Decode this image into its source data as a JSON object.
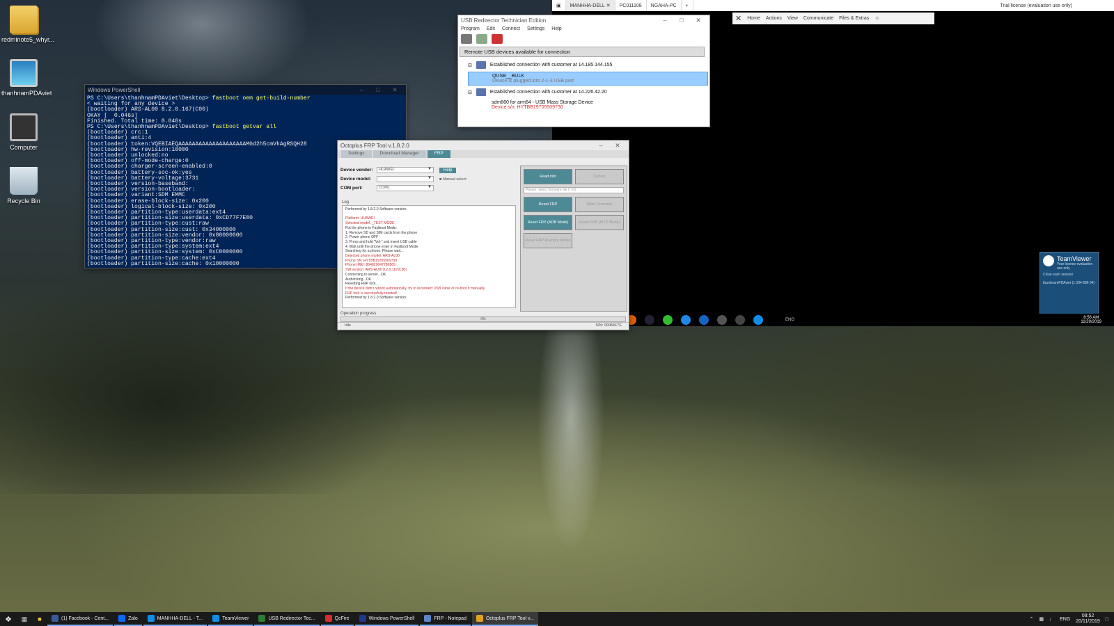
{
  "desktop": {
    "icons": [
      {
        "label": "redminote5_whyr..."
      },
      {
        "label": "thanhnamPDAviet"
      },
      {
        "label": "Computer"
      },
      {
        "label": "Recycle Bin"
      }
    ]
  },
  "powershell": {
    "title": "Windows PowerShell",
    "lines": [
      "PS C:\\Users\\thanhnamPDAviet\\Desktop> fastboot oem get-build-number",
      "< waiting for any device >",
      "(bootloader) ARS-AL00 8.2.0.167(C00)",
      "OKAY [  0.046s]",
      "Finished. Total time: 0.048s",
      "PS C:\\Users\\thanhnamPDAviet\\Desktop> fastboot getvar all",
      "(bootloader) crc:1",
      "(bootloader) anti:4",
      "(bootloader) token:VQEBIAEQAAAAAAAAAAAAAAAAAAAAMGd2h5cmVkAgRSQH28",
      "(bootloader) hw-revision:10000",
      "(bootloader) unlocked:no",
      "(bootloader) off-mode-charge:0",
      "(bootloader) charger-screen-enabled:0",
      "(bootloader) battery-soc-ok:yes",
      "(bootloader) battery-voltage:3731",
      "(bootloader) version-baseband:",
      "(bootloader) version-bootloader:",
      "(bootloader) variant:SDM EMMC",
      "(bootloader) erase-block-size: 0x200",
      "(bootloader) logical-block-size: 0x200",
      "(bootloader) partition-type:userdata:ext4",
      "(bootloader) partition-size:userdata: 0xCD77F7E00",
      "(bootloader) partition-type:cust:raw",
      "(bootloader) partition-size:cust: 0x34000000",
      "(bootloader) partition-size:vendor: 0x80000000",
      "(bootloader) partition-type:vendor:raw",
      "(bootloader) partition-type:system:ext4",
      "(bootloader) partition-size:system: 0xC0000000",
      "(bootloader) partition-type:cache:ext4",
      "(bootloader) partition-size:cache: 0x10000000"
    ]
  },
  "teamviewer": {
    "tabs": [
      "MANHHA-DELL",
      "PC011108",
      "NGAHA-PC"
    ],
    "license": "Trial license (evaluation use only)",
    "toolbar": [
      "Home",
      "Actions",
      "View",
      "Communicate",
      "Files & Extras"
    ],
    "panel_title": "TeamViewer",
    "panel_sub": "Your license evaluation use only",
    "panel_row1": "Close each session",
    "panel_row2": "thanhnamPDAviet (1 004 886 04)",
    "remote_clock_time": "8:56 AM",
    "remote_clock_date": "11/20/2019",
    "remote_tray": "ENG"
  },
  "usb": {
    "title": "USB Redirector Technician Edition",
    "menu": [
      "Program",
      "Edit",
      "Connect",
      "Settings",
      "Help"
    ],
    "header": "Remote USB devices available for connection",
    "conn1": "Established connection with customer at 14.185.144.155",
    "dev1_name": "QUSB__BULK",
    "dev1_sub": "Device is plugged into 2-1-3 USB port",
    "conn2": "Established connection with customer at 14.226.42.20",
    "dev2_name": "sdm660 for arm64 - USB Mass Storage Device",
    "dev2_sub": "Device s/n: HYTBB19705509730"
  },
  "octoplus": {
    "title": "Octoplus FRP Tool v.1.8.2.0",
    "tabs": [
      "Settings",
      "Download Manager",
      "FRP"
    ],
    "vendor_label": "Device vendor:",
    "vendor_value": "HUAWEI",
    "model_label": "Device model:",
    "model_value": "",
    "com_label": "COM port:",
    "com_value": "COM1",
    "help": "Help",
    "manual": "Manual select",
    "log_label": "Log",
    "log": [
      {
        "t": "Performed by 1.8.2.0 Software version.",
        "c": ""
      },
      {
        "t": "",
        "c": ""
      },
      {
        "t": "Platform: HUAWEI",
        "c": "r"
      },
      {
        "t": "Selected model: _TEST-MODE",
        "c": "r"
      },
      {
        "t": "Put the phone in Fastboot Mode:",
        "c": ""
      },
      {
        "t": "1. Remove SD and SIM cards from the phone",
        "c": ""
      },
      {
        "t": "2. Power phone OFF",
        "c": ""
      },
      {
        "t": "3. Press and hold \"Vol-\" and insert USB cable",
        "c": ""
      },
      {
        "t": "4. Wait until the phone enter in Fastboot Mode",
        "c": ""
      },
      {
        "t": "Searching for a phone. Please wait...",
        "c": ""
      },
      {
        "t": "Detected phone model: ARS-AL00",
        "c": "r"
      },
      {
        "t": "Phone SN: HYTBB19705509730",
        "c": "r"
      },
      {
        "t": "Phone IMEI: 864829047786569",
        "c": "r"
      },
      {
        "t": "SW version: ARS-AL00 8.2.0.167(C00)",
        "c": "r"
      },
      {
        "t": "Connecting to server...OK",
        "c": ""
      },
      {
        "t": "Authorizing...OK",
        "c": ""
      },
      {
        "t": "Resetting FRP lock...",
        "c": ""
      },
      {
        "t": "If the device didn't reboot automatically, try to reconnect USB cable or re-boot it manually.",
        "c": "r"
      },
      {
        "t": "FRP lock is successfully reseted!",
        "c": "r"
      },
      {
        "t": "Performed by 1.8.2.0 Software version.",
        "c": ""
      }
    ],
    "buttons": {
      "read_info": "Read info",
      "cancel": "Cancel",
      "fw_placeholder": "Please: select firmware file (*.ini)",
      "reset_frp": "Reset FRP",
      "write_fw": "Write Firmware",
      "reset_adb": "Reset FRP (ADB Mode)",
      "reset_mtk": "Reset FRP (MTK Mode)",
      "reset_factory": "Reset FRP (Factory Mode)"
    },
    "progress_label": "Operation progress",
    "progress_percent": "0%",
    "progress_value": 0,
    "status": "Idle",
    "serial": "S/N: 00084F7E"
  },
  "taskbar": {
    "items": [
      {
        "label": "(1) Facebook - Cent...",
        "color": "#3b5998"
      },
      {
        "label": "Zalo",
        "color": "#0a68ff"
      },
      {
        "label": "MANHHA-DELL - T...",
        "color": "#0e8ee9"
      },
      {
        "label": "TeamViewer",
        "color": "#0e8ee9"
      },
      {
        "label": "USB Redirector Tec...",
        "color": "#2e7d32"
      },
      {
        "label": "QcFire",
        "color": "#d32f2f"
      },
      {
        "label": "Windows PowerShell",
        "color": "#1e3a8a"
      },
      {
        "label": "FRP - Notepad",
        "color": "#5b87c5"
      },
      {
        "label": "Octoplus FRP Tool v...",
        "color": "#e0a020"
      }
    ],
    "lang": "ENG",
    "time": "08:52",
    "date": "20/11/2019"
  }
}
